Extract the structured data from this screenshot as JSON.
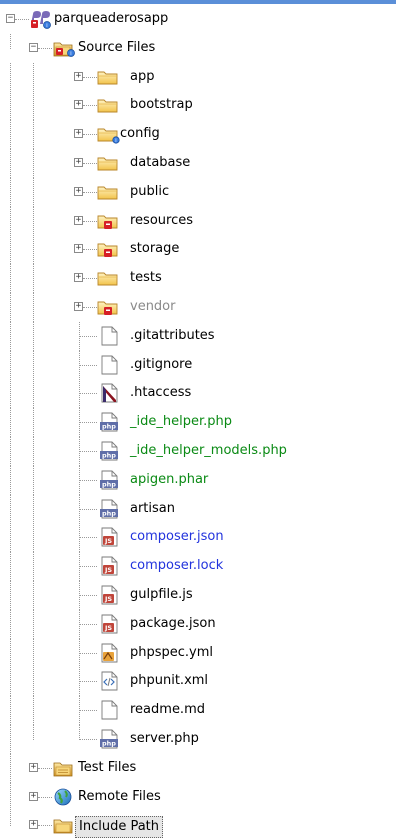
{
  "project": {
    "name": "parqueaderosapp"
  },
  "source_files": {
    "label": "Source Files"
  },
  "folders": [
    {
      "label": "app"
    },
    {
      "label": "bootstrap"
    },
    {
      "label": "config"
    },
    {
      "label": "database"
    },
    {
      "label": "public"
    },
    {
      "label": "resources"
    },
    {
      "label": "storage"
    },
    {
      "label": "tests"
    },
    {
      "label": "vendor"
    }
  ],
  "files": [
    {
      "label": ".gitattributes",
      "icon": "blank-file-icon",
      "color": "#000000"
    },
    {
      "label": ".gitignore",
      "icon": "blank-file-icon",
      "color": "#000000"
    },
    {
      "label": ".htaccess",
      "icon": "htaccess-file-icon",
      "color": "#000000"
    },
    {
      "label": "_ide_helper.php",
      "icon": "php-file-icon",
      "color": "#0a8a14"
    },
    {
      "label": "_ide_helper_models.php",
      "icon": "php-file-icon",
      "color": "#0a8a14"
    },
    {
      "label": "apigen.phar",
      "icon": "php-file-icon",
      "color": "#0a8a14"
    },
    {
      "label": "artisan",
      "icon": "php-file-icon",
      "color": "#000000"
    },
    {
      "label": "composer.json",
      "icon": "js-file-icon",
      "color": "#2233dd"
    },
    {
      "label": "composer.lock",
      "icon": "js-file-icon",
      "color": "#2233dd"
    },
    {
      "label": "gulpfile.js",
      "icon": "js-file-icon",
      "color": "#000000"
    },
    {
      "label": "package.json",
      "icon": "js-file-icon",
      "color": "#000000"
    },
    {
      "label": "phpspec.yml",
      "icon": "yml-file-icon",
      "color": "#000000"
    },
    {
      "label": "phpunit.xml",
      "icon": "xml-file-icon",
      "color": "#000000"
    },
    {
      "label": "readme.md",
      "icon": "blank-file-icon",
      "color": "#000000"
    },
    {
      "label": "server.php",
      "icon": "php-file-icon",
      "color": "#000000"
    }
  ],
  "other_nodes": [
    {
      "label": "Test Files"
    },
    {
      "label": "Remote Files"
    },
    {
      "label": "Include Path"
    }
  ]
}
